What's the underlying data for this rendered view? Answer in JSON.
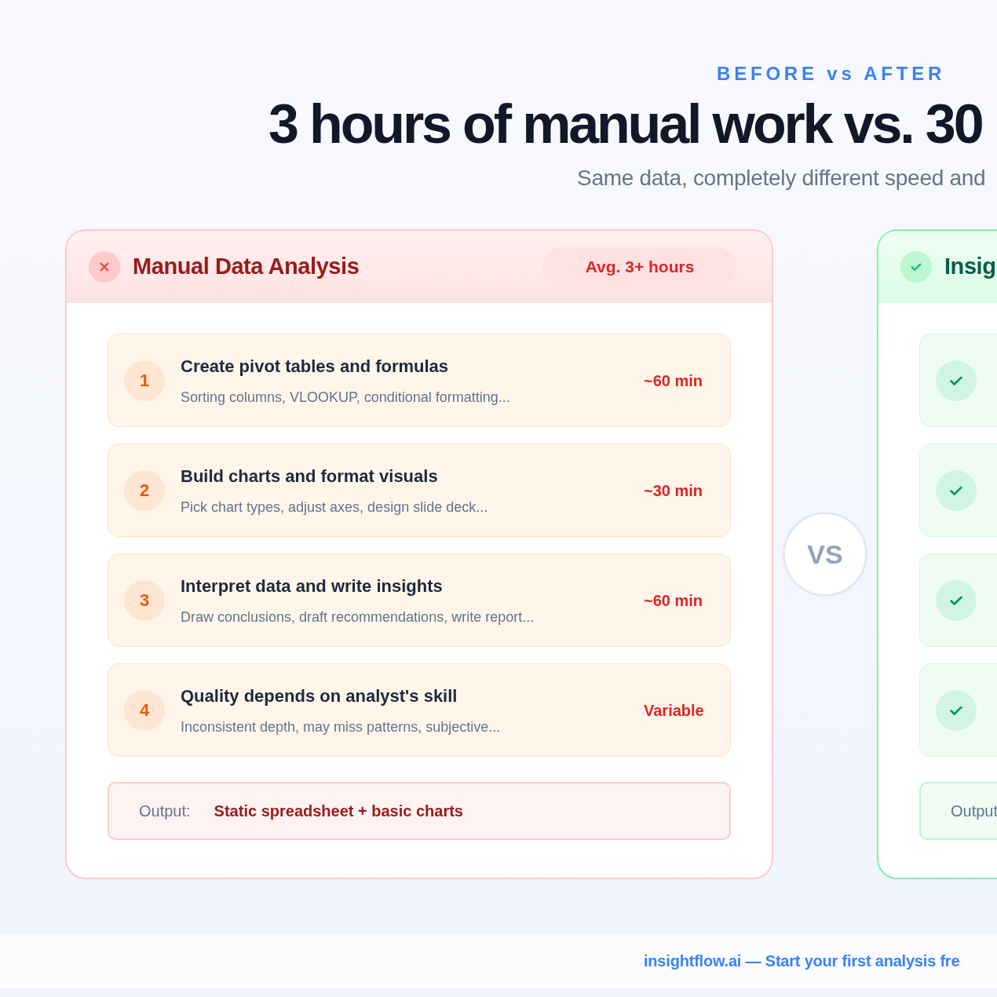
{
  "eyebrow": "BEFORE vs AFTER",
  "title": "3 hours of manual work vs. 30",
  "subtitle": "Same data, completely different speed and",
  "vs": "VS",
  "footer": "insightflow.ai — Start your first analysis fre",
  "cards": [
    {
      "kind": "before",
      "title": "Manual Data Analysis",
      "badge": "Avg. 3+ hours",
      "steps": [
        {
          "marker": "1",
          "title": "Create pivot tables and formulas",
          "detail": "Sorting columns, VLOOKUP, conditional formatting...",
          "time": "~60 min"
        },
        {
          "marker": "2",
          "title": "Build charts and format visuals",
          "detail": "Pick chart types, adjust axes, design slide deck...",
          "time": "~30 min"
        },
        {
          "marker": "3",
          "title": "Interpret data and write insights",
          "detail": "Draw conclusions, draft recommendations, write report...",
          "time": "~60 min"
        },
        {
          "marker": "4",
          "title": "Quality depends on analyst's skill",
          "detail": "Inconsistent depth, may miss patterns, subjective...",
          "time": "Variable"
        }
      ],
      "output_label": "Output:",
      "output_value": "Static spreadsheet + basic charts"
    },
    {
      "kind": "after",
      "title": "Insig",
      "steps": [
        {
          "kind": "check"
        },
        {
          "kind": "check"
        },
        {
          "kind": "check"
        },
        {
          "kind": "check"
        }
      ],
      "output_label": "Output"
    }
  ]
}
